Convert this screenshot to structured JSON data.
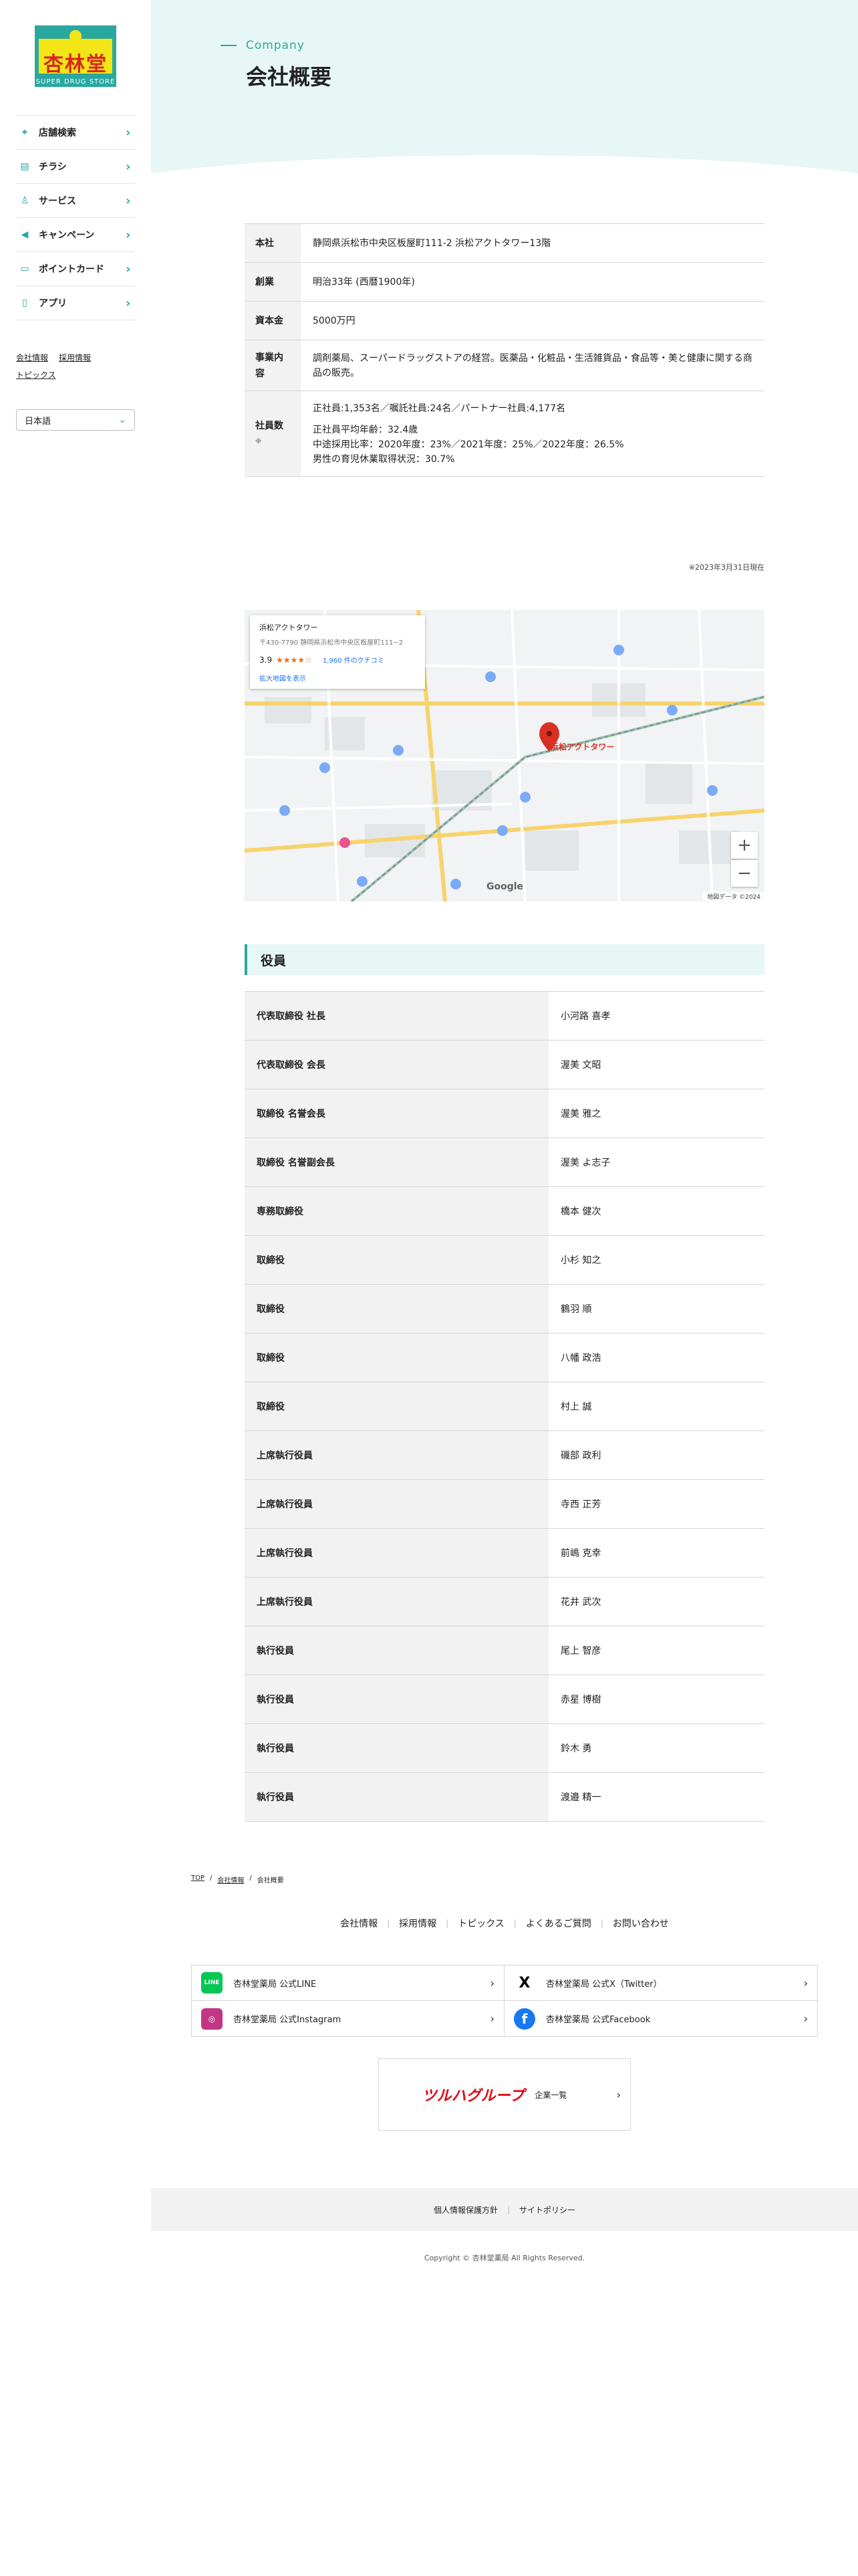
{
  "logo": {
    "name": "杏林堂",
    "sub": "SUPER DRUG STORE"
  },
  "nav": [
    {
      "label": "店舗検索",
      "icon": "map-pin-icon"
    },
    {
      "label": "チラシ",
      "icon": "flyer-icon"
    },
    {
      "label": "サービス",
      "icon": "person-icon"
    },
    {
      "label": "キャンペーン",
      "icon": "megaphone-icon"
    },
    {
      "label": "ポイントカード",
      "icon": "card-icon"
    },
    {
      "label": "アプリ",
      "icon": "phone-icon"
    }
  ],
  "sublinks": [
    "会社情報",
    "採用情報",
    "トピックス"
  ],
  "language": "日本語",
  "hero": {
    "en": "Company",
    "title": "会社概要"
  },
  "company": [
    {
      "k": "本社",
      "v": [
        "静岡県浜松市中央区板屋町111-2 浜松アクトタワー13階"
      ]
    },
    {
      "k": "創業",
      "v": [
        "明治33年 (西暦1900年)"
      ]
    },
    {
      "k": "資本金",
      "v": [
        "5000万円"
      ]
    },
    {
      "k": "事業内容",
      "v": [
        "調剤薬局、スーパードラッグストアの経営。医薬品・化粧品・生活雑貨品・食品等・美と健康に関する商品の販売。"
      ]
    },
    {
      "k": "社員数",
      "note": "※",
      "v": [
        "正社員:1,353名／嘱託社員:24名／パートナー社員:4,177名",
        "",
        "正社員平均年齢：32.4歳",
        "中途採用比率：2020年度：23%／2021年度：25%／2022年度：26.5%",
        "男性の育児休業取得状況：30.7%"
      ]
    }
  ],
  "company_note": "※2023年3月31日現在",
  "map": {
    "card_title": "浜松アクトタワー",
    "card_address": "〒430-7790 静岡県浜松市中央区板屋町111−2",
    "rating": "3.9",
    "stars": "★★★★☆",
    "reviews": "1,960 件のクチコミ",
    "link": "拡大地図を表示",
    "pin_label": "浜松アクトタワー",
    "google": "Google",
    "footer": "地図データ ©2024",
    "zoom_in": "+",
    "zoom_out": "−"
  },
  "officers_title": "役員",
  "officers": [
    {
      "k": "代表取締役 社長",
      "v": "小河路 喜孝"
    },
    {
      "k": "代表取締役 会長",
      "v": "渥美 文昭"
    },
    {
      "k": "取締役 名誉会長",
      "v": "渥美 雅之"
    },
    {
      "k": "取締役 名誉副会長",
      "v": "渥美 よ志子"
    },
    {
      "k": "専務取締役",
      "v": "橋本 健次"
    },
    {
      "k": "取締役",
      "v": "小杉 知之"
    },
    {
      "k": "取締役",
      "v": "鶴羽 順"
    },
    {
      "k": "取締役",
      "v": "八幡 政浩"
    },
    {
      "k": "取締役",
      "v": "村上 誠"
    },
    {
      "k": "上席執行役員",
      "v": "磯部 政利"
    },
    {
      "k": "上席執行役員",
      "v": "寺西 正芳"
    },
    {
      "k": "上席執行役員",
      "v": "前嶋 克幸"
    },
    {
      "k": "上席執行役員",
      "v": "花井 武次"
    },
    {
      "k": "執行役員",
      "v": "尾上 智彦"
    },
    {
      "k": "執行役員",
      "v": "赤星 博樹"
    },
    {
      "k": "執行役員",
      "v": "鈴木 勇"
    },
    {
      "k": "執行役員",
      "v": "渡邉 精一"
    }
  ],
  "breadcrumb": [
    "TOP",
    "会社情報",
    "会社概要"
  ],
  "footer_nav": [
    "会社情報",
    "採用情報",
    "トピックス",
    "よくあるご質問",
    "お問い合わせ"
  ],
  "social": [
    {
      "label": "杏林堂薬局 公式LINE",
      "icon": "line-icon",
      "color": "#06c755",
      "glyph": "LINE"
    },
    {
      "label": "杏林堂薬局 公式X（Twitter）",
      "icon": "x-icon",
      "color": "#000000",
      "glyph": "X"
    },
    {
      "label": "杏林堂薬局 公式Instagram",
      "icon": "instagram-icon",
      "color": "#c13584",
      "glyph": "◎"
    },
    {
      "label": "杏林堂薬局 公式Facebook",
      "icon": "facebook-icon",
      "color": "#1877f2",
      "glyph": "f"
    }
  ],
  "group": {
    "brand": "ツルハグループ",
    "label": "企業一覧"
  },
  "footer_links": [
    "個人情報保護方針",
    "サイトポリシー"
  ],
  "copyright": "Copyright © 杏林堂薬局 All Rights Reserved.",
  "colors": {
    "accent": "#2aa8a0",
    "hero_bg": "#e6f7f5",
    "logo_yellow": "#f2e616",
    "logo_red": "#d8261e"
  }
}
